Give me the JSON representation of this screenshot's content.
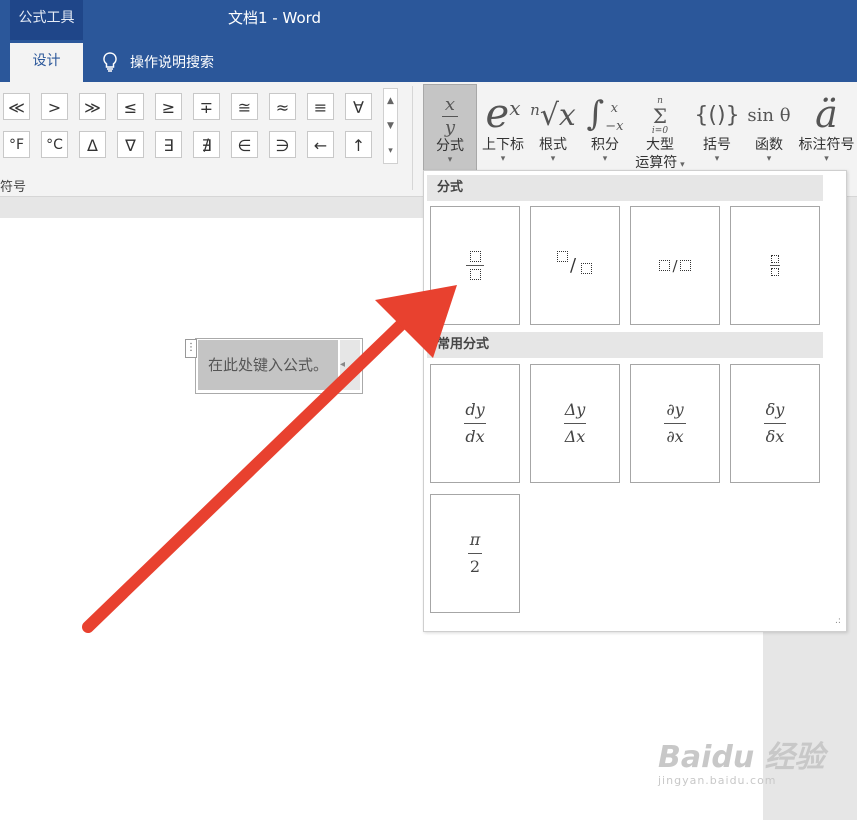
{
  "titlebar": {
    "context_tab": "公式工具",
    "document_title": "文档1  -  Word"
  },
  "tabs": {
    "design": "设计",
    "tell_me": "操作说明搜索"
  },
  "symbols": {
    "row1": [
      "≪",
      ">",
      "≫",
      "≤",
      "≥",
      "∓",
      "≅",
      "≈",
      "≡",
      "∀"
    ],
    "row2": [
      "°F",
      "°C",
      "Δ",
      "∇",
      "∃",
      "∄",
      "∈",
      "∋",
      "←",
      "↑"
    ],
    "group_label": "符号"
  },
  "structures": [
    {
      "label": "分式",
      "glyph_top": "x",
      "glyph_bottom": "y",
      "active": true
    },
    {
      "label": "上下标",
      "glyph": "eˣ"
    },
    {
      "label": "根式",
      "glyph": "ⁿ√x"
    },
    {
      "label": "积分",
      "glyph": "∫"
    },
    {
      "label": "大型",
      "label2": "运算符",
      "glyph": "Σ"
    },
    {
      "label": "括号",
      "glyph": "{()}"
    },
    {
      "label": "函数",
      "glyph": "sin θ"
    },
    {
      "label": "标注符号",
      "glyph": "ä"
    }
  ],
  "equation": {
    "placeholder": "在此处键入公式。"
  },
  "gallery": {
    "section1_title": "分式",
    "section2_title": "常用分式",
    "common": [
      {
        "num": "dy",
        "den": "dx"
      },
      {
        "num": "Δy",
        "den": "Δx"
      },
      {
        "num": "∂y",
        "den": "∂x"
      },
      {
        "num": "δy",
        "den": "δx"
      },
      {
        "num": "π",
        "den": "2"
      }
    ]
  },
  "watermark": {
    "brand": "Baidu 经验",
    "url": "jingyan.baidu.com"
  },
  "colors": {
    "word_blue": "#2b579a",
    "arrow_red": "#e8412f"
  }
}
